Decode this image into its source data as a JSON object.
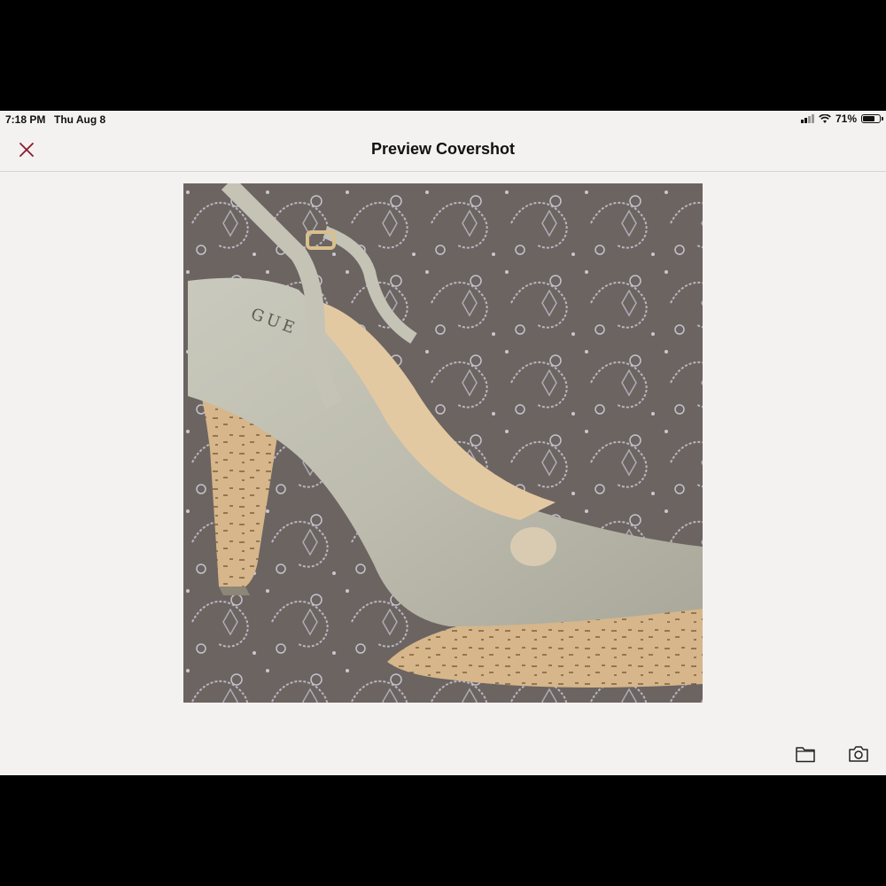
{
  "status_bar": {
    "time": "7:18 PM",
    "date": "Thu Aug 8",
    "battery_percent": "71%",
    "battery_level": 0.71,
    "icons": [
      "cellular-signal-icon",
      "wifi-icon",
      "battery-icon"
    ]
  },
  "nav": {
    "title": "Preview Covershot",
    "close_icon": "close-icon"
  },
  "photo": {
    "subject_brand_text": "GUE"
  },
  "toolbar": {
    "icons": [
      "folder-icon",
      "camera-icon"
    ]
  },
  "colors": {
    "background": "#f4f1f1",
    "close_accent": "#8a1a2a",
    "text": "#111111"
  }
}
